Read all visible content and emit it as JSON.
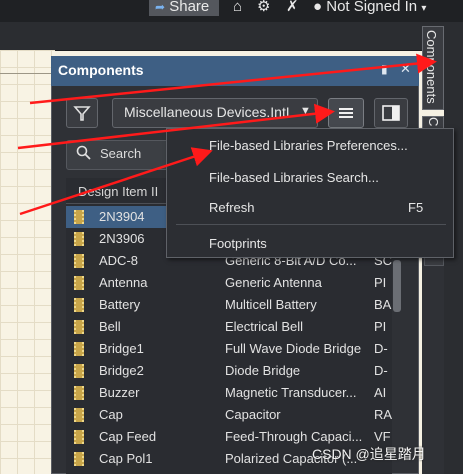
{
  "topbar": {
    "share_label": "Share",
    "share_icon": "share-arrow-icon",
    "home_icon": "home-icon",
    "settings_icon": "gear-icon",
    "notify_icon": "bell-off-icon",
    "user_icon": "user-icon",
    "user_label": "Not Signed In"
  },
  "panel": {
    "title": "Components",
    "pin_icon": "pin-icon",
    "close_icon": "close-icon",
    "filter_icon": "filter-icon",
    "library_value": "Miscellaneous Devices.IntLi",
    "dropdown_icon": "chevron-down-icon",
    "menu_icon": "hamburger-menu-icon",
    "layout_icon": "panel-layout-icon",
    "search_placeholder": "Search",
    "search_icon": "search-icon",
    "column_header": "Design Item II"
  },
  "side_tabs": [
    "Components",
    "C"
  ],
  "components": [
    {
      "name": "2N3904",
      "description": "",
      "lib": "",
      "selected": true
    },
    {
      "name": "2N3906",
      "description": "",
      "lib": ""
    },
    {
      "name": "ADC-8",
      "description": "Generic 8-Bit A/D Co...",
      "lib": "SC"
    },
    {
      "name": "Antenna",
      "description": "Generic Antenna",
      "lib": "PI"
    },
    {
      "name": "Battery",
      "description": "Multicell Battery",
      "lib": "BA"
    },
    {
      "name": "Bell",
      "description": "Electrical Bell",
      "lib": "PI"
    },
    {
      "name": "Bridge1",
      "description": "Full Wave Diode Bridge",
      "lib": "D-"
    },
    {
      "name": "Bridge2",
      "description": "Diode Bridge",
      "lib": "D-"
    },
    {
      "name": "Buzzer",
      "description": "Magnetic Transducer...",
      "lib": "AI"
    },
    {
      "name": "Cap",
      "description": "Capacitor",
      "lib": "RA"
    },
    {
      "name": "Cap Feed",
      "description": "Feed-Through Capaci...",
      "lib": "VF"
    },
    {
      "name": "Cap Pol1",
      "description": "Polarized Capacitor (...",
      "lib": ""
    }
  ],
  "menu": {
    "items": [
      {
        "label": "File-based Libraries Preferences...",
        "shortcut": ""
      },
      {
        "label": "File-based Libraries Search...",
        "shortcut": ""
      },
      {
        "label": "Refresh",
        "shortcut": "F5"
      },
      {
        "label": "Footprints",
        "shortcut": ""
      }
    ]
  },
  "watermark": "CSDN @追星踏月",
  "colors": {
    "panel_header": "#3e5f84",
    "selection": "#3e5f84",
    "annotation_arrow": "#ff1a1a",
    "chip": "#c9a64a"
  }
}
